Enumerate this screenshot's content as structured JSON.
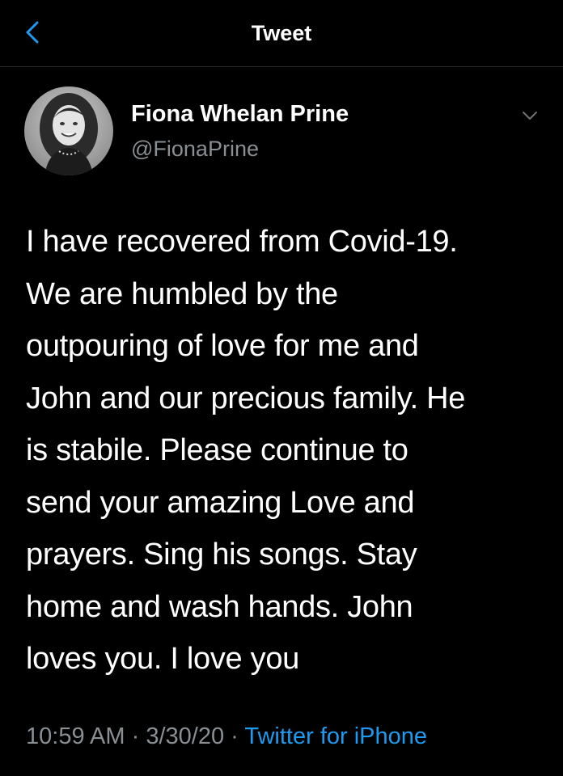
{
  "header": {
    "title": "Tweet",
    "back_icon": "back-chevron-icon",
    "accent_color": "#1d9bf0"
  },
  "tweet": {
    "author_name": "Fiona Whelan Prine",
    "author_handle": "@FionaPrine",
    "menu_icon": "chevron-down-icon",
    "text": "I have recovered from Covid-19.\nWe are humbled by the\noutpouring of love for me and\nJohn and our precious family. He\nis stabile. Please continue to\nsend your amazing Love and\nprayers. Sing his songs. Stay\nhome and wash hands. John\nloves you. I love you",
    "time": "10:59 AM",
    "separator": "·",
    "date": "3/30/20",
    "source": "Twitter for iPhone"
  },
  "colors": {
    "background": "#000000",
    "text": "#ffffff",
    "muted": "#8a8f94",
    "link": "#1d9bf0"
  }
}
